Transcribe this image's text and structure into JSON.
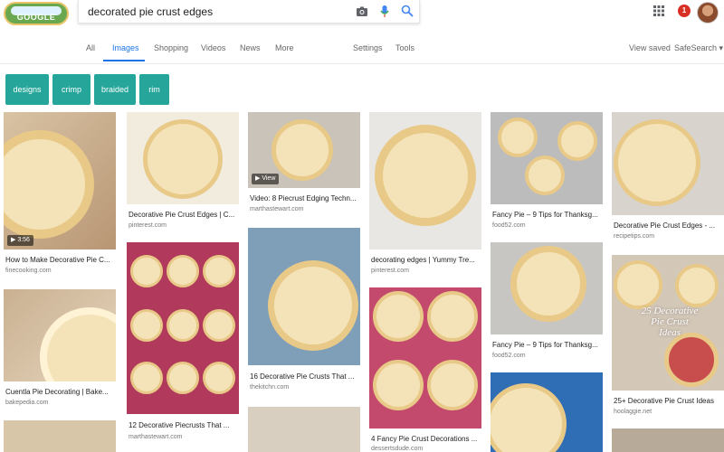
{
  "logo": {
    "text": "GOOGLE"
  },
  "search": {
    "query": "decorated pie crust edges"
  },
  "header": {
    "notification_count": "1"
  },
  "nav": {
    "all": "All",
    "images": "Images",
    "shopping": "Shopping",
    "videos": "Videos",
    "news": "News",
    "more": "More",
    "settings": "Settings",
    "tools": "Tools",
    "view_saved": "View saved",
    "safesearch": "SafeSearch ▾"
  },
  "chips": [
    "designs",
    "crimp",
    "braided",
    "rim"
  ],
  "results": [
    {
      "caption": "How to Make Decorative Pie C...",
      "source": "finecooking.com",
      "badge": "▶ 3:56"
    },
    {
      "caption": "Decorative Pie Crust Edges | C...",
      "source": "pinterest.com"
    },
    {
      "caption": "Video: 8 Piecrust Edging Techn...",
      "source": "marthastewart.com",
      "badge": "▶ View"
    },
    {
      "caption": "decorating edges | Yummy Tre...",
      "source": "pinterest.com"
    },
    {
      "caption": "Fancy Pie – 9 Tips for Thanksg...",
      "source": "food52.com"
    },
    {
      "caption": "Decorative Pie Crust Edges - ...",
      "source": "recipetips.com"
    },
    {
      "caption": "Cuentla Pie Decorating | Bake...",
      "source": "bakepedia.com"
    },
    {
      "caption": "12 Decorative Piecrusts That ...",
      "source": "marthastewart.com"
    },
    {
      "caption": "16 Decorative Pie Crusts That ...",
      "source": "thekitchn.com"
    },
    {
      "caption": "4 Fancy Pie Crust Decorations ...",
      "source": "dessertsdude.com"
    },
    {
      "caption": "Fancy Pie – 9 Tips for Thanksg...",
      "source": "food52.com"
    },
    {
      "caption": "25+ Decorative Pie Crust Ideas",
      "source": "hoolaggie.net",
      "overlay": "25 Decorative Pie Crust Ideas"
    }
  ],
  "colors": {
    "accent": "#1a73e8",
    "chip": "#26a69a",
    "badge": "#d93025"
  }
}
